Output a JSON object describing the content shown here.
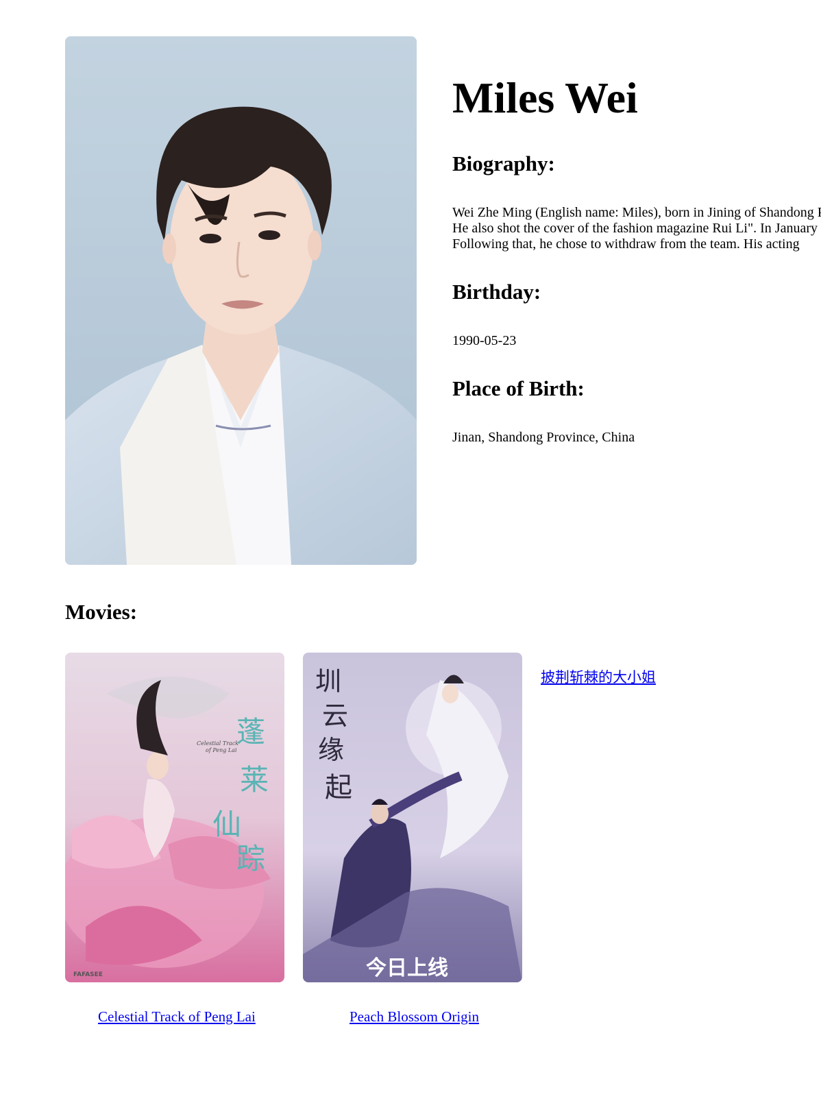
{
  "person": {
    "name": "Miles Wei",
    "photo_alt": "Miles Wei"
  },
  "biography": {
    "heading": "Biography:",
    "lines": [
      "Wei Zhe Ming (English name: Miles), born in Jining of Shandong Province, China",
      "He also shot the cover of the fashion magazine Rui Li\". In January",
      "Following that, he chose to withdraw from the team. His acting"
    ]
  },
  "birthday": {
    "heading": "Birthday:",
    "value": "1990-05-23"
  },
  "place_of_birth": {
    "heading": "Place of Birth:",
    "value": "Jinan, Shandong Province, China"
  },
  "movies": {
    "heading": "Movies:",
    "items": [
      {
        "title": "Celestial Track of Peng Lai",
        "poster_text": "蓬莱仙踪",
        "poster_subtitle": "Celestial Track of Peng Lai",
        "poster_badge": "FAFASEE"
      },
      {
        "title": "Peach Blossom Origin",
        "poster_text": "圳云缘起",
        "poster_banner": "今日上线"
      },
      {
        "title": "披荆斩棘的大小姐"
      }
    ]
  },
  "colors": {
    "link": "#0000ee",
    "photo_background": "#bfd0de"
  }
}
